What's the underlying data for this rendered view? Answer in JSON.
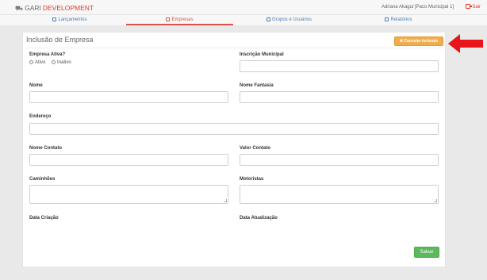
{
  "header": {
    "brand_part1": "GARI",
    "brand_part2": "DEVELOPMENT",
    "user_info": "Adriana Akagui [Paco Municipal 1]",
    "logout_label": "Sair"
  },
  "nav": {
    "tabs": [
      {
        "label": "Lançamentos",
        "icon": "list-icon",
        "active": false
      },
      {
        "label": "Empresas",
        "icon": "building-icon",
        "active": true
      },
      {
        "label": "Grupos e Usuários",
        "icon": "users-icon",
        "active": false
      },
      {
        "label": "Relatórios",
        "icon": "file-icon",
        "active": false
      }
    ]
  },
  "form": {
    "title": "Inclusão de Empresa",
    "cancel_label": "✖ Cancelar Inclusão",
    "empresa_ativa_label": "Empresa Ativa?",
    "radio_ativo": "Ativo",
    "radio_inativo": "Inativo",
    "inscricao_municipal_label": "Inscrição Municipal",
    "nome_label": "Nome",
    "nome_fantasia_label": "Nome Fantasia",
    "endereco_label": "Endereço",
    "nome_contato_label": "Nome Contato",
    "valor_contato_label": "Valor Contato",
    "caminhoes_label": "Caminhões",
    "motoristas_label": "Motoristas",
    "data_criacao_label": "Data Criação",
    "data_atualizacao_label": "Data Atualização",
    "save_label": "Salvar"
  },
  "colors": {
    "accent_red": "#d9534f",
    "cancel_orange": "#f0ad4e",
    "save_green": "#5cb85c",
    "link_blue": "#4a7fb8",
    "arrow_red": "#e8161b"
  }
}
